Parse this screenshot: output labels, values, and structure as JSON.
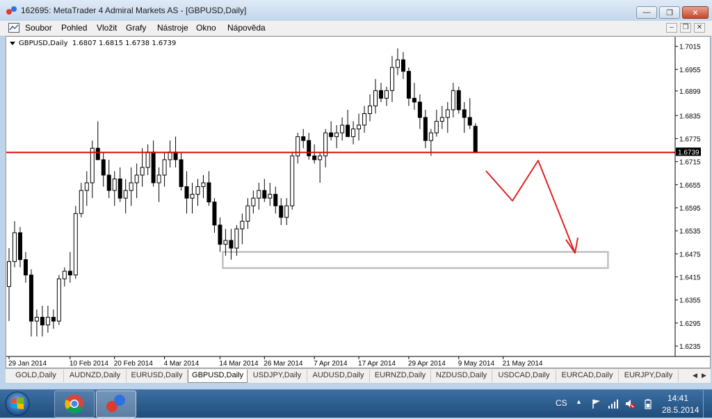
{
  "window": {
    "title": "162695: MetaTrader 4 Admiral Markets AS - [GBPUSD,Daily]",
    "minimize_icon": "minimize-icon",
    "restore_icon": "restore-icon",
    "close_icon": "close-icon"
  },
  "menu": {
    "items": [
      "Soubor",
      "Pohled",
      "Vložit",
      "Grafy",
      "Nástroje",
      "Okno",
      "Nápověda"
    ]
  },
  "chart": {
    "info_line": "GBPUSD,Daily  1.6807 1.6815 1.6738 1.6739",
    "current_price_label": "1.6739"
  },
  "chart_data": {
    "type": "candlestick",
    "symbol": "GBPUSD",
    "timeframe": "Daily",
    "last_bar_ohlc": {
      "open": 1.6807,
      "high": 1.6815,
      "low": 1.6738,
      "close": 1.6739
    },
    "ylim": [
      1.6208,
      1.7038
    ],
    "y_ticks": [
      "1.7015",
      "1.6955",
      "1.6899",
      "1.6835",
      "1.6775",
      "1.6715",
      "1.6655",
      "1.6595",
      "1.6535",
      "1.6475",
      "1.6415",
      "1.6355",
      "1.6295",
      "1.6235"
    ],
    "x_ticks": [
      "29 Jan 2014",
      "10 Feb 2014",
      "20 Feb 2014",
      "4 Mar 2014",
      "14 Mar 2014",
      "26 Mar 2014",
      "7 Apr 2014",
      "17 Apr 2014",
      "29 Apr 2014",
      "9 May 2014",
      "21 May 2014"
    ],
    "horizontal_line": {
      "price": 1.6739,
      "color": "#e00000"
    },
    "zone_rectangle": {
      "price_top": 1.648,
      "price_bottom": 1.6438,
      "color": "#c0c0c0"
    },
    "candles": [
      [
        1.639,
        1.649,
        1.63,
        1.6455
      ],
      [
        1.6455,
        1.656,
        1.644,
        1.653
      ],
      [
        1.653,
        1.6545,
        1.644,
        1.646
      ],
      [
        1.646,
        1.648,
        1.64,
        1.642
      ],
      [
        1.642,
        1.6435,
        1.626,
        1.63
      ],
      [
        1.63,
        1.633,
        1.626,
        1.631
      ],
      [
        1.631,
        1.634,
        1.626,
        1.629
      ],
      [
        1.629,
        1.634,
        1.627,
        1.631
      ],
      [
        1.631,
        1.633,
        1.628,
        1.63
      ],
      [
        1.63,
        1.642,
        1.629,
        1.641
      ],
      [
        1.641,
        1.644,
        1.639,
        1.643
      ],
      [
        1.643,
        1.648,
        1.64,
        1.642
      ],
      [
        1.642,
        1.66,
        1.641,
        1.658
      ],
      [
        1.658,
        1.666,
        1.657,
        1.664
      ],
      [
        1.664,
        1.669,
        1.66,
        1.666
      ],
      [
        1.666,
        1.677,
        1.662,
        1.675
      ],
      [
        1.675,
        1.682,
        1.672,
        1.672
      ],
      [
        1.672,
        1.674,
        1.665,
        1.668
      ],
      [
        1.668,
        1.672,
        1.662,
        1.664
      ],
      [
        1.664,
        1.669,
        1.66,
        1.667
      ],
      [
        1.667,
        1.67,
        1.661,
        1.662
      ],
      [
        1.662,
        1.667,
        1.658,
        1.664
      ],
      [
        1.664,
        1.67,
        1.66,
        1.666
      ],
      [
        1.666,
        1.671,
        1.662,
        1.668
      ],
      [
        1.668,
        1.675,
        1.665,
        1.67
      ],
      [
        1.67,
        1.676,
        1.668,
        1.674
      ],
      [
        1.674,
        1.677,
        1.665,
        1.666
      ],
      [
        1.666,
        1.67,
        1.661,
        1.668
      ],
      [
        1.668,
        1.674,
        1.665,
        1.672
      ],
      [
        1.672,
        1.677,
        1.67,
        1.674
      ],
      [
        1.674,
        1.678,
        1.67,
        1.672
      ],
      [
        1.672,
        1.674,
        1.664,
        1.665
      ],
      [
        1.665,
        1.669,
        1.658,
        1.662
      ],
      [
        1.662,
        1.666,
        1.658,
        1.663
      ],
      [
        1.663,
        1.667,
        1.66,
        1.665
      ],
      [
        1.665,
        1.668,
        1.662,
        1.666
      ],
      [
        1.666,
        1.669,
        1.66,
        1.661
      ],
      [
        1.661,
        1.662,
        1.653,
        1.655
      ],
      [
        1.655,
        1.657,
        1.648,
        1.65
      ],
      [
        1.65,
        1.654,
        1.647,
        1.651
      ],
      [
        1.651,
        1.654,
        1.646,
        1.649
      ],
      [
        1.649,
        1.655,
        1.647,
        1.654
      ],
      [
        1.654,
        1.658,
        1.65,
        1.656
      ],
      [
        1.656,
        1.662,
        1.654,
        1.66
      ],
      [
        1.66,
        1.664,
        1.658,
        1.662
      ],
      [
        1.662,
        1.666,
        1.659,
        1.664
      ],
      [
        1.664,
        1.667,
        1.661,
        1.662
      ],
      [
        1.662,
        1.666,
        1.66,
        1.663
      ],
      [
        1.663,
        1.665,
        1.658,
        1.66
      ],
      [
        1.66,
        1.662,
        1.655,
        1.657
      ],
      [
        1.657,
        1.662,
        1.655,
        1.66
      ],
      [
        1.66,
        1.674,
        1.659,
        1.673
      ],
      [
        1.673,
        1.679,
        1.671,
        1.678
      ],
      [
        1.678,
        1.68,
        1.675,
        1.677
      ],
      [
        1.677,
        1.679,
        1.672,
        1.673
      ],
      [
        1.673,
        1.676,
        1.671,
        1.672
      ],
      [
        1.672,
        1.674,
        1.666,
        1.673
      ],
      [
        1.673,
        1.68,
        1.67,
        1.679
      ],
      [
        1.679,
        1.682,
        1.677,
        1.678
      ],
      [
        1.678,
        1.681,
        1.675,
        1.679
      ],
      [
        1.679,
        1.683,
        1.677,
        1.681
      ],
      [
        1.681,
        1.685,
        1.679,
        1.678
      ],
      [
        1.678,
        1.682,
        1.676,
        1.68
      ],
      [
        1.68,
        1.684,
        1.677,
        1.681
      ],
      [
        1.681,
        1.686,
        1.679,
        1.684
      ],
      [
        1.684,
        1.689,
        1.682,
        1.686
      ],
      [
        1.686,
        1.693,
        1.684,
        1.69
      ],
      [
        1.69,
        1.692,
        1.687,
        1.688
      ],
      [
        1.688,
        1.691,
        1.686,
        1.69
      ],
      [
        1.69,
        1.699,
        1.687,
        1.696
      ],
      [
        1.696,
        1.701,
        1.694,
        1.698
      ],
      [
        1.698,
        1.7,
        1.693,
        1.695
      ],
      [
        1.695,
        1.696,
        1.686,
        1.688
      ],
      [
        1.688,
        1.692,
        1.685,
        1.687
      ],
      [
        1.687,
        1.689,
        1.68,
        1.683
      ],
      [
        1.683,
        1.685,
        1.675,
        1.677
      ],
      [
        1.677,
        1.68,
        1.673,
        1.679
      ],
      [
        1.679,
        1.685,
        1.678,
        1.682
      ],
      [
        1.682,
        1.686,
        1.68,
        1.683
      ],
      [
        1.683,
        1.687,
        1.679,
        1.685
      ],
      [
        1.685,
        1.692,
        1.683,
        1.69
      ],
      [
        1.69,
        1.691,
        1.684,
        1.685
      ],
      [
        1.685,
        1.687,
        1.679,
        1.683
      ],
      [
        1.683,
        1.688,
        1.68,
        1.681
      ],
      [
        1.6807,
        1.6815,
        1.6738,
        1.6739
      ]
    ]
  },
  "annotations": {
    "arrow_color": "#dd2222"
  },
  "tabs": {
    "items": [
      "GOLD,Daily",
      "AUDNZD,Daily",
      "EURUSD,Daily",
      "GBPUSD,Daily",
      "USDJPY,Daily",
      "AUDUSD,Daily",
      "EURNZD,Daily",
      "NZDUSD,Daily",
      "USDCAD,Daily",
      "EURCAD,Daily",
      "EURJPY,Daily"
    ],
    "active": "GBPUSD,Daily"
  },
  "taskbar": {
    "language": "CS",
    "time": "14:41",
    "date": "28.5.2014",
    "icons": [
      "windows-start-icon",
      "chrome-icon",
      "metatrader-icon"
    ]
  }
}
